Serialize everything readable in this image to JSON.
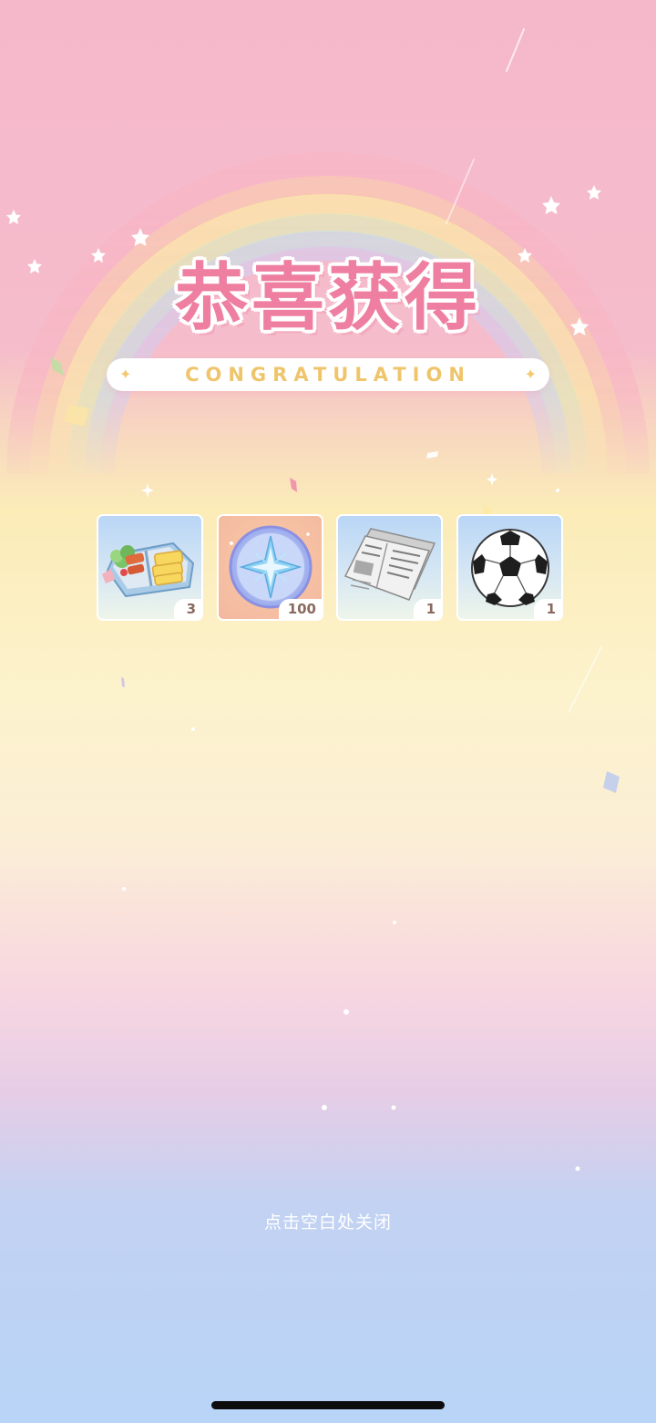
{
  "screen": {
    "title": "恭喜获得",
    "subtitle": "CONGRATULATION",
    "close_hint": "点击空白处关闭"
  },
  "rewards": [
    {
      "icon": "bento-box-icon",
      "quantity": "3"
    },
    {
      "icon": "star-coin-icon",
      "quantity": "100"
    },
    {
      "icon": "newspaper-icon",
      "quantity": "1"
    },
    {
      "icon": "soccer-ball-icon",
      "quantity": "1"
    }
  ],
  "colors": {
    "title": "#ee7fa0",
    "subtitle": "#efc56c",
    "background_top": "#f5b8cb",
    "background_mid": "#fcf2cc",
    "background_bottom": "#b8d4f7"
  }
}
